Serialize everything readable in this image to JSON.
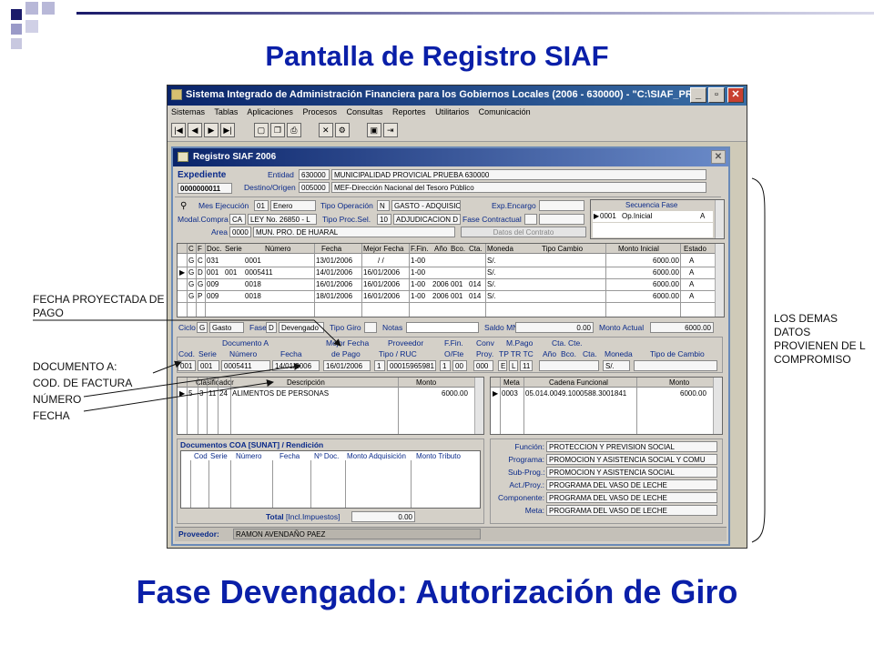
{
  "slide": {
    "title": "Pantalla de Registro SIAF",
    "subtitle": "Fase Devengado: Autorización de Giro",
    "annotations": {
      "fecha_proyectada": "FECHA PROYECTADA DE PAGO",
      "documento_a": "DOCUMENTO  A:",
      "cod_factura": "COD. DE FACTURA",
      "numero": "NÚMERO",
      "fecha": "FECHA",
      "demas_datos": "LOS DEMAS DATOS PROVIENEN DE L COMPROMISO"
    },
    "colors": {
      "title": "#0a1fa8",
      "titlebar": "#0a246a",
      "window_bg": "#d4d0c8"
    }
  },
  "window": {
    "title": "Sistema Integrado de Administración Financiera para los Gobiernos Locales (2006 - 630000) - \"C:\\SIAF_PRESUP...",
    "menu": [
      "Sistemas",
      "Tablas",
      "Aplicaciones",
      "Procesos",
      "Consultas",
      "Reportes",
      "Utilitarios",
      "Comunicación"
    ]
  },
  "form": {
    "title": "Registro SIAF 2006",
    "expediente_label": "Expediente",
    "expediente": "0000000011",
    "entidad_label": "Entidad",
    "entidad_code": "630000",
    "entidad_name": "MUNICIPALIDAD PROVICIAL PRUEBA 630000",
    "destino_label": "Destino/Origen",
    "destino_code": "005000",
    "destino_name": "MEF-Dirección Nacional del Tesoro Público",
    "mes_label": "Mes Ejecución",
    "mes_code": "01",
    "mes_name": "Enero",
    "tipo_op_label": "Tipo Operación",
    "tipo_op_code": "N",
    "tipo_op_name": "GASTO - ADQUISICION D",
    "exp_encargo_label": "Exp.Encargo",
    "modal_label": "Modal.Compra",
    "modal_code": "CA",
    "modal_name": "LEY No. 26850 - L",
    "tipo_proc_label": "Tipo Proc.Sel.",
    "tipo_proc_code": "10",
    "tipo_proc_name": "ADJUDICACION D",
    "fase_contr_label": "Fase Contractual",
    "area_label": "Area",
    "area_code": "0000",
    "area_name": "MUN. PRO. DE HUARAL",
    "datos_contrato": "Datos del Contrato",
    "secuencia_title": "Secuencia Fase",
    "secuencia_row": {
      "code": "0001",
      "name": "Op.Inicial",
      "flag": "A"
    },
    "main_headers": [
      "C",
      "F",
      "Doc.",
      "Serie",
      "Número",
      "Fecha",
      "Mejor Fecha",
      "F.Fin.",
      "Año",
      "Bco.",
      "Cta.",
      "Moneda",
      "Tipo Cambio",
      "Monto Inicial",
      "Estado"
    ],
    "main_rows": [
      [
        "G",
        "C",
        "031",
        "",
        "0001",
        "13/01/2006",
        "/ /",
        "1-00",
        "",
        "",
        "",
        "S/.",
        "",
        "6000.00",
        "A"
      ],
      [
        "G",
        "D",
        "001",
        "001",
        "0005411",
        "14/01/2006",
        "16/01/2006",
        "1-00",
        "",
        "",
        "",
        "S/.",
        "",
        "6000.00",
        "A"
      ],
      [
        "G",
        "G",
        "009",
        "",
        "0018",
        "16/01/2006",
        "16/01/2006",
        "1-00",
        "2006",
        "001",
        "014",
        "S/.",
        "",
        "6000.00",
        "A"
      ],
      [
        "G",
        "P",
        "009",
        "",
        "0018",
        "18/01/2006",
        "16/01/2006",
        "1-00",
        "2006",
        "001",
        "014",
        "S/.",
        "",
        "6000.00",
        "A"
      ]
    ],
    "ciclo_label": "Ciclo",
    "ciclo_code": "G",
    "ciclo_name": "Gasto",
    "fase_label": "Fase",
    "fase_code": "D",
    "fase_name": "Devengado",
    "tipo_giro_label": "Tipo Giro",
    "notas_label": "Notas",
    "saldo_label": "Saldo MN",
    "saldo": "0.00",
    "monto_actual_label": "Monto Actual",
    "monto_actual": "6000.00",
    "docA_title": "Documento A",
    "docA_headers": [
      "Cod.",
      "Serie",
      "Número",
      "Fecha"
    ],
    "docA_values": [
      "001",
      "001",
      "0005411",
      "14/01/2006"
    ],
    "mejor_fecha_title": "Mejor Fecha",
    "mejor_fecha_sub": "de Pago",
    "mejor_fecha": "16/01/2006",
    "proveedor_title": "Proveedor",
    "proveedor_sub": "Tipo / RUC",
    "proveedor_tipo": "1",
    "proveedor_ruc": "00015965981",
    "ffin_title": "F.Fin.",
    "ffin_sub": "O/Fte",
    "ffin_a": "1",
    "ffin_b": "00",
    "conv_title": "Conv",
    "conv_sub": "Proy.",
    "conv": "000",
    "mpago_title": "M.Pago",
    "mpago_sub": "TP TR TC",
    "mpago_vals": [
      "E",
      "L",
      "11"
    ],
    "ctacte_title": "Cta. Cte.",
    "ctacte_sub": [
      "Año",
      "Bco.",
      "Cta."
    ],
    "moneda_label": "Moneda",
    "moneda": "S/.",
    "tipo_cambio_label": "Tipo de Cambio",
    "clasif_headers": [
      "Clasificador",
      "Descripción",
      "Monto"
    ],
    "clasif_row": {
      "a": "5",
      "b": "3",
      "c": "11",
      "d": "24",
      "desc": "ALIMENTOS DE PERSONAS",
      "monto": "6000.00"
    },
    "meta_headers": [
      "Meta",
      "Cadena Funcional",
      "Monto"
    ],
    "meta_row": {
      "meta": "0003",
      "cadena": "05.014.0049.1000588.3001841",
      "monto": "6000.00"
    },
    "coa_title": "Documentos COA [SUNAT] / Rendición",
    "coa_headers": [
      "Cod",
      "Serie",
      "Número",
      "Fecha",
      "Nº Doc.",
      "Monto Adquisición",
      "Monto Tributo"
    ],
    "total_label": "Total",
    "total_sub": "[Incl.Impuestos]",
    "total": "0.00",
    "funcional": [
      {
        "label": "Función:",
        "value": "PROTECCION Y PREVISION SOCIAL"
      },
      {
        "label": "Programa:",
        "value": "PROMOCION Y  ASISTENCIA SOCIAL Y COMU"
      },
      {
        "label": "Sub-Prog.:",
        "value": "PROMOCION Y ASISTENCIA SOCIAL"
      },
      {
        "label": "Act./Proy.:",
        "value": "PROGRAMA DEL VASO DE LECHE"
      },
      {
        "label": "Componente:",
        "value": "PROGRAMA DEL VASO DE LECHE"
      },
      {
        "label": "Meta:",
        "value": "PROGRAMA DEL VASO DE LECHE"
      }
    ],
    "proveedor_bar_label": "Proveedor:",
    "proveedor_name": "RAMON AVENDAÑO PAEZ"
  }
}
